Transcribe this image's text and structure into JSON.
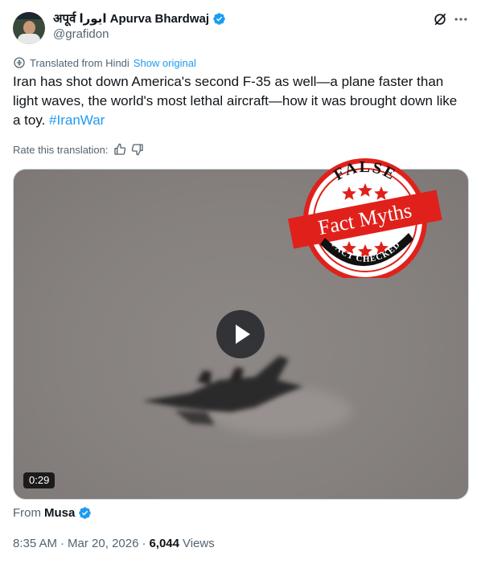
{
  "author": {
    "name": "अपूर्व ایورا Apurva Bhardwaj",
    "handle": "@grafidon"
  },
  "translation": {
    "label": "Translated from Hindi",
    "show_original": "Show original"
  },
  "tweet": {
    "text": "Iran has shot down America's second F-35 as well—a plane faster than light waves, the world's most lethal aircraft—how it was brought down like a toy. ",
    "hashtag": "#IranWar"
  },
  "rate": {
    "label": "Rate this translation:"
  },
  "video": {
    "duration": "0:29"
  },
  "stamp": {
    "top_text": "FALSE",
    "banner_text": "Fact Myths",
    "bottom_text": "FACT CHECKED",
    "color": "#e0211b"
  },
  "source": {
    "label": "From",
    "name": "Musa"
  },
  "meta": {
    "time": "8:35 AM",
    "separator": "·",
    "date": "Mar 20, 2026",
    "views_count": "6,044",
    "views_label": "Views"
  },
  "colors": {
    "accent": "#1d9bf0",
    "secondary_text": "#536471",
    "primary_text": "#0f1419"
  },
  "icons": {
    "verified": "verified-badge-icon",
    "grok": "grok-icon",
    "more": "more-icon",
    "translate": "translate-icon",
    "thumbs_up": "thumbs-up-icon",
    "thumbs_down": "thumbs-down-icon",
    "play": "play-icon"
  }
}
